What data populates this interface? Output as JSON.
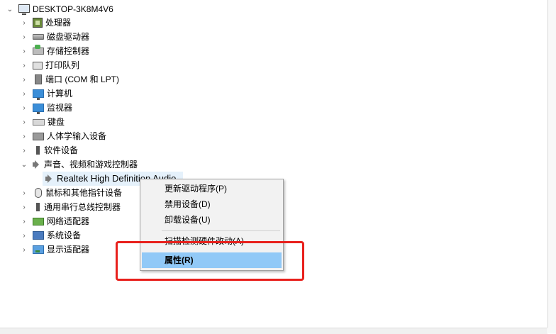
{
  "tree": {
    "root": "DESKTOP-3K8M4V6",
    "items": [
      {
        "label": "处理器",
        "icon": "cpu-icon"
      },
      {
        "label": "磁盘驱动器",
        "icon": "disk-drive-icon"
      },
      {
        "label": "存储控制器",
        "icon": "storage-controller-icon"
      },
      {
        "label": "打印队列",
        "icon": "printer-icon"
      },
      {
        "label": "端口 (COM 和 LPT)",
        "icon": "port-icon"
      },
      {
        "label": "计算机",
        "icon": "computer-icon"
      },
      {
        "label": "监视器",
        "icon": "monitor-icon"
      },
      {
        "label": "键盘",
        "icon": "keyboard-icon"
      },
      {
        "label": "人体学输入设备",
        "icon": "hid-icon"
      },
      {
        "label": "软件设备",
        "icon": "software-device-icon"
      },
      {
        "label": "声音、视频和游戏控制器",
        "icon": "speaker-icon"
      },
      {
        "label": "鼠标和其他指针设备",
        "icon": "mouse-icon"
      },
      {
        "label": "通用串行总线控制器",
        "icon": "usb-icon"
      },
      {
        "label": "网络适配器",
        "icon": "network-adapter-icon"
      },
      {
        "label": "系统设备",
        "icon": "system-device-icon"
      },
      {
        "label": "显示适配器",
        "icon": "display-adapter-icon"
      }
    ],
    "child_sound": "Realtek High Definition Audio"
  },
  "context_menu": {
    "items": [
      "更新驱动程序(P)",
      "禁用设备(D)",
      "卸载设备(U)",
      "扫描检测硬件改动(A)",
      "属性(R)"
    ]
  },
  "colors": {
    "menu_highlight": "#91c9f7",
    "annotation_box": "#e8201c"
  }
}
